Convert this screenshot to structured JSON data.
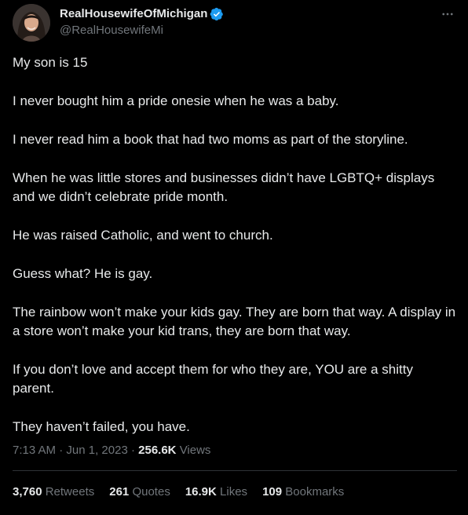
{
  "author": {
    "display_name": "RealHousewifeOfMichigan",
    "handle": "@RealHousewifeMi",
    "verified_color": "#1d9bf0"
  },
  "more_icon": "more-horizontal-icon",
  "paragraphs": [
    "My son is 15",
    "I never bought him a pride onesie when he was a baby.",
    "I never read him a book that had two moms as part of the storyline.",
    "When he was little stores and businesses didn’t have LGBTQ+ displays and we didn’t celebrate pride month.",
    "He was raised Catholic, and went to church.",
    "Guess what?  He is gay.",
    "The rainbow won’t make your kids gay.  They are born that way.  A display in a store won’t make your kid trans, they are born that way.",
    "If you don’t love and accept them for who they are, YOU are a shitty parent.",
    "They haven’t failed, you have."
  ],
  "meta": {
    "time": "7:13 AM",
    "separator": "·",
    "date": "Jun 1, 2023",
    "views_count": "256.6K",
    "views_label": "Views"
  },
  "stats": {
    "retweets_count": "3,760",
    "retweets_label": "Retweets",
    "quotes_count": "261",
    "quotes_label": "Quotes",
    "likes_count": "16.9K",
    "likes_label": "Likes",
    "bookmarks_count": "109",
    "bookmarks_label": "Bookmarks"
  },
  "colors": {
    "background": "#000000",
    "text": "#e7e9ea",
    "secondary": "#71767b",
    "divider": "#2f3336"
  }
}
